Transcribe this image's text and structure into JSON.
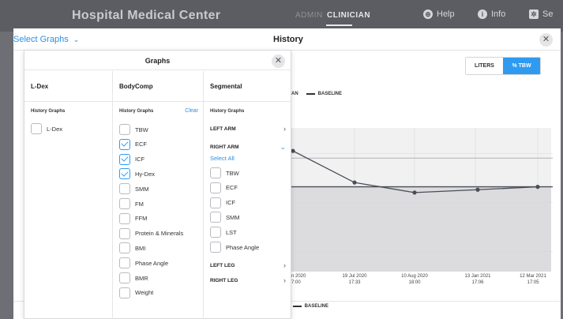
{
  "app": {
    "title": "Hospital Medical Center"
  },
  "topnav": {
    "admin": "ADMIN",
    "clinician": "CLINICIAN",
    "help": "Help",
    "info": "Info",
    "settings": "Se"
  },
  "window": {
    "select_graphs": "Select Graphs",
    "title": "History"
  },
  "units": {
    "liters": "LITERS",
    "tbw": "% TBW",
    "selected": "% TBW"
  },
  "legend": {
    "top_prefix": "AN",
    "top_baseline": "BASELINE",
    "bottom_prefix": "AN",
    "bottom_baseline": "BASELINE"
  },
  "panel": {
    "title": "Graphs",
    "ldex": {
      "header": "L-Dex",
      "sub": "History Graphs",
      "items": [
        {
          "label": "L-Dex",
          "checked": false
        }
      ]
    },
    "bodycomp": {
      "header": "BodyComp",
      "sub": "History Graphs",
      "clear": "Clear",
      "items": [
        {
          "label": "TBW",
          "checked": false
        },
        {
          "label": "ECF",
          "checked": true
        },
        {
          "label": "ICF",
          "checked": true
        },
        {
          "label": "Hy-Dex",
          "checked": true
        },
        {
          "label": "SMM",
          "checked": false
        },
        {
          "label": "FM",
          "checked": false
        },
        {
          "label": "FFM",
          "checked": false
        },
        {
          "label": "Protein & Minerals",
          "checked": false
        },
        {
          "label": "BMI",
          "checked": false
        },
        {
          "label": "Phase Angle",
          "checked": false
        },
        {
          "label": "BMR",
          "checked": false
        },
        {
          "label": "Weight",
          "checked": false
        }
      ]
    },
    "segmental": {
      "header": "Segmental",
      "sub": "History Graphs",
      "left_arm": "LEFT ARM",
      "right_arm": "RIGHT ARM",
      "select_all": "Select All",
      "items": [
        {
          "label": "TBW",
          "checked": false
        },
        {
          "label": "ECF",
          "checked": false
        },
        {
          "label": "ICF",
          "checked": false
        },
        {
          "label": "SMM",
          "checked": false
        },
        {
          "label": "LST",
          "checked": false
        },
        {
          "label": "Phase Angle",
          "checked": false
        }
      ],
      "left_leg": "LEFT LEG",
      "right_leg": "RIGHT LEG"
    }
  },
  "chart_data": {
    "type": "line",
    "x_labels": [
      {
        "date": "n 2020",
        "time": "7:00"
      },
      {
        "date": "19 Jul 2020",
        "time": "17:33"
      },
      {
        "date": "10 Aug 2020",
        "time": "18:00"
      },
      {
        "date": "13 Jan 2021",
        "time": "17:06"
      },
      {
        "date": "12 Mar 2021",
        "time": "17:05"
      }
    ],
    "values": [
      0.31,
      0.62,
      0.78,
      0.74,
      0.71
    ],
    "baseline": 0.71,
    "upper_limit": 0.33,
    "band_fraction": [
      0.66,
      1.0
    ],
    "colors": {
      "line": "#4a4d57",
      "band": "#e6e6e8",
      "bg": "#f1f1f2",
      "grid": "#d8d9db"
    }
  }
}
